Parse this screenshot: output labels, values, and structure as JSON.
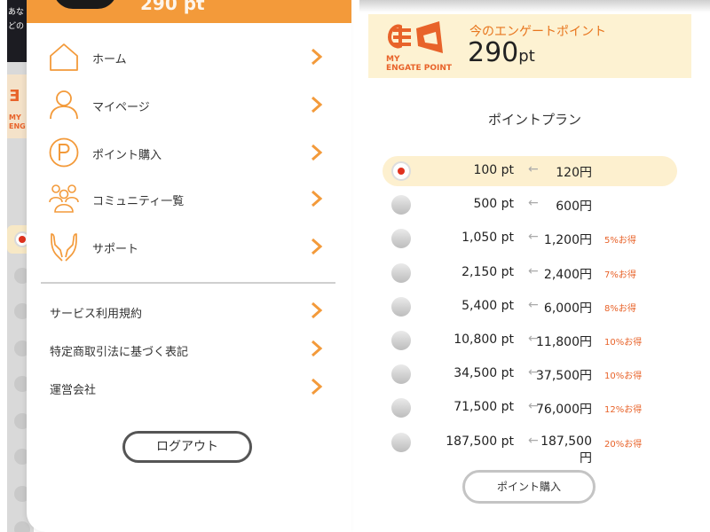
{
  "drawer": {
    "header_points": "290 pt",
    "menu": [
      {
        "label": "ホーム",
        "icon": "home-icon"
      },
      {
        "label": "マイページ",
        "icon": "person-icon"
      },
      {
        "label": "ポイント購入",
        "icon": "points-coin-icon"
      },
      {
        "label": "コミュニティ一覧",
        "icon": "community-icon"
      },
      {
        "label": "サポート",
        "icon": "support-hands-icon"
      }
    ],
    "links": [
      {
        "label": "サービス利用規約"
      },
      {
        "label": "特定商取引法に基づく表記"
      },
      {
        "label": "運営会社"
      }
    ],
    "logout_label": "ログアウト",
    "background_snippet": [
      "あな",
      "どの"
    ],
    "accent_color": "#f39a3a"
  },
  "points": {
    "logo_text": "MY ENGATE POINT",
    "logo_lines": [
      "MY",
      "ENGATE POINT"
    ],
    "label": "今のエンゲートポイント",
    "value": "290",
    "unit": "pt"
  },
  "plans": {
    "title": "ポイントプラン",
    "arrow": "←",
    "items": [
      {
        "points": "100 pt",
        "price": "120円",
        "discount": "",
        "selected": true
      },
      {
        "points": "500 pt",
        "price": "600円",
        "discount": "",
        "selected": false
      },
      {
        "points": "1,050 pt",
        "price": "1,200円",
        "discount": "5%お得",
        "selected": false
      },
      {
        "points": "2,150 pt",
        "price": "2,400円",
        "discount": "7%お得",
        "selected": false
      },
      {
        "points": "5,400 pt",
        "price": "6,000円",
        "discount": "8%お得",
        "selected": false
      },
      {
        "points": "10,800 pt",
        "price": "11,800円",
        "discount": "10%お得",
        "selected": false
      },
      {
        "points": "34,500 pt",
        "price": "37,500円",
        "discount": "10%お得",
        "selected": false
      },
      {
        "points": "71,500 pt",
        "price": "76,000円",
        "discount": "12%お得",
        "selected": false
      },
      {
        "points": "187,500 pt",
        "price": "187,500円",
        "discount": "20%お得",
        "selected": false
      }
    ],
    "buy_label": "ポイント購入"
  },
  "colors": {
    "accent": "#f39a3a",
    "brand_orange": "#e8632a",
    "banner_bg": "#fdf2d2",
    "selected_row_bg": "#fdf0cf",
    "radio_selected": "#e0321e"
  }
}
